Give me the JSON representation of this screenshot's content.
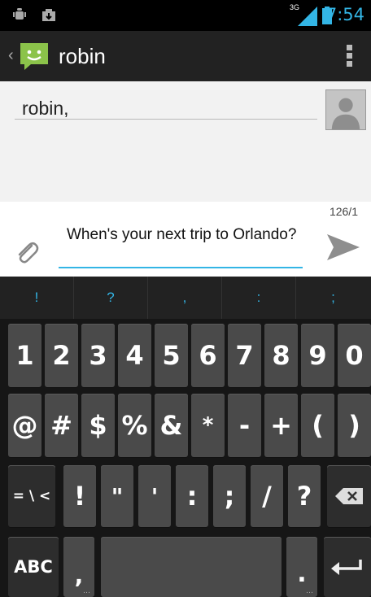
{
  "status": {
    "network_label": "3G",
    "time": "7:54",
    "icons": [
      "android-debug-icon",
      "download-icon",
      "signal-icon",
      "battery-icon"
    ]
  },
  "actionbar": {
    "title": "robin",
    "icons": [
      "up-chevron-icon",
      "messaging-app-icon",
      "overflow-menu-icon"
    ]
  },
  "recipients": {
    "to_text": "robin,",
    "icons": [
      "contact-photo-icon"
    ]
  },
  "compose": {
    "counter": "126/1",
    "message": "When's your next trip to Orlando?",
    "icons": [
      "attach-icon",
      "send-icon"
    ]
  },
  "keyboard": {
    "suggestions": [
      "!",
      "?",
      ",",
      ":",
      ";"
    ],
    "row_numbers": [
      "1",
      "2",
      "3",
      "4",
      "5",
      "6",
      "7",
      "8",
      "9",
      "0"
    ],
    "row_symbols1": [
      "@",
      "#",
      "$",
      "%",
      "&",
      "*",
      "-",
      "+",
      "(",
      ")"
    ],
    "row_symbols2": [
      "= \\ <",
      "!",
      "\"",
      "'",
      ":",
      ";",
      "/",
      "?"
    ],
    "row_bottom": {
      "abc": "ABC",
      "comma": ",",
      "space": "",
      "period": ".",
      "enter": "enter"
    },
    "colors": {
      "accent": "#33b5e5",
      "key": "#4a4a4a",
      "key_dark": "#2d2d2d"
    }
  }
}
